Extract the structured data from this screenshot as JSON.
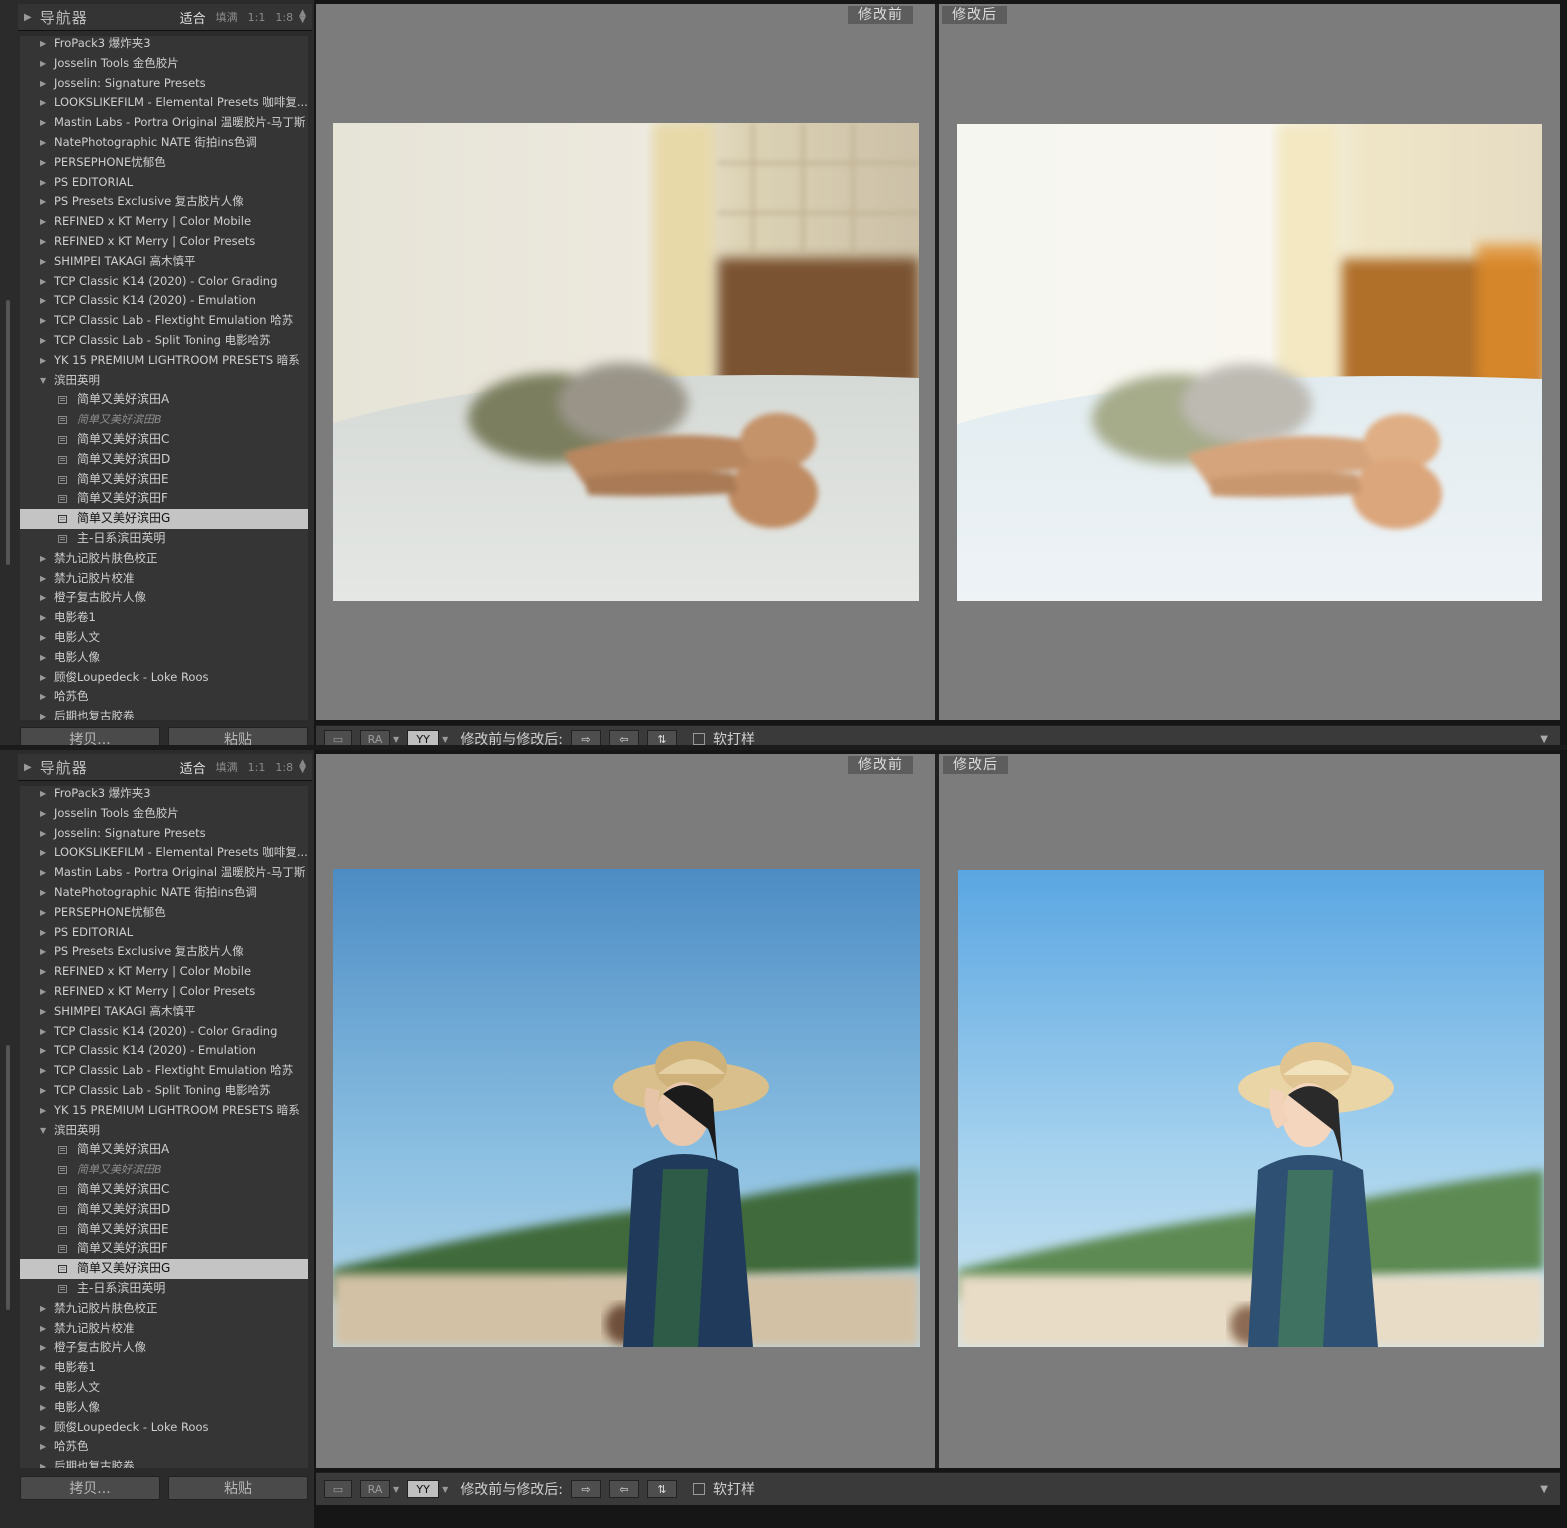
{
  "navigator": {
    "title": "导航器",
    "zoom_options": [
      "适合",
      "填满",
      "1:1",
      "1:8"
    ]
  },
  "presets": [
    {
      "label": "FroPack3 爆炸夹3",
      "type": "folder"
    },
    {
      "label": "Josselin Tools 金色胶片",
      "type": "folder"
    },
    {
      "label": "Josselin: Signature Presets",
      "type": "folder"
    },
    {
      "label": "LOOKSLIKEFILM - Elemental Presets 咖啡复...",
      "type": "folder"
    },
    {
      "label": "Mastin Labs - Portra Original 温暖胶片-马丁斯",
      "type": "folder"
    },
    {
      "label": "NatePhotographic NATE 街拍ins色调",
      "type": "folder"
    },
    {
      "label": "PERSEPHONE忧郁色",
      "type": "folder"
    },
    {
      "label": "PS EDITORIAL",
      "type": "folder"
    },
    {
      "label": "PS Presets Exclusive 复古胶片人像",
      "type": "folder"
    },
    {
      "label": "REFINED x KT Merry | Color Mobile",
      "type": "folder"
    },
    {
      "label": "REFINED x KT Merry | Color Presets",
      "type": "folder"
    },
    {
      "label": "SHIMPEI TAKAGI 高木慎平",
      "type": "folder"
    },
    {
      "label": "TCP Classic K14 (2020) - Color Grading",
      "type": "folder"
    },
    {
      "label": "TCP Classic K14 (2020) - Emulation",
      "type": "folder"
    },
    {
      "label": "TCP Classic Lab - Flextight Emulation 哈苏",
      "type": "folder"
    },
    {
      "label": "TCP Classic Lab - Split Toning 电影哈苏",
      "type": "folder"
    },
    {
      "label": "YK 15 PREMIUM LIGHTROOM PRESETS 暗系",
      "type": "folder"
    },
    {
      "label": "滨田英明",
      "type": "open"
    },
    {
      "label": "简单又美好滨田A",
      "type": "child"
    },
    {
      "label": "简单又美好滨田B",
      "type": "child",
      "italic": true
    },
    {
      "label": "简单又美好滨田C",
      "type": "child"
    },
    {
      "label": "简单又美好滨田D",
      "type": "child"
    },
    {
      "label": "简单又美好滨田E",
      "type": "child"
    },
    {
      "label": "简单又美好滨田F",
      "type": "child"
    },
    {
      "label": "简单又美好滨田G",
      "type": "child",
      "selected": true
    },
    {
      "label": "主-日系滨田英明",
      "type": "child"
    },
    {
      "label": "禁九记胶片肤色校正",
      "type": "folder"
    },
    {
      "label": "禁九记胶片校准",
      "type": "folder"
    },
    {
      "label": "橙子复古胶片人像",
      "type": "folder"
    },
    {
      "label": "电影卷1",
      "type": "folder"
    },
    {
      "label": "电影人文",
      "type": "folder"
    },
    {
      "label": "电影人像",
      "type": "folder"
    },
    {
      "label": "顾俊Loupedeck - Loke Roos",
      "type": "folder"
    },
    {
      "label": "哈苏色",
      "type": "folder"
    },
    {
      "label": "后期也复古胶卷",
      "type": "folder"
    }
  ],
  "buttons": {
    "copy": "拷贝...",
    "paste": "粘贴"
  },
  "compare": {
    "before": "修改前",
    "after": "修改后"
  },
  "toolbar": {
    "ra": "RA",
    "yy": "YY",
    "before_after_label": "修改前与修改后:",
    "soft_proof": "软打样"
  },
  "icons": [
    "disclosure-triangle-icon",
    "preset-icon",
    "loupe-view-icon",
    "swap-left-icon",
    "swap-right-icon",
    "swap-icon",
    "dropdown-icon"
  ]
}
